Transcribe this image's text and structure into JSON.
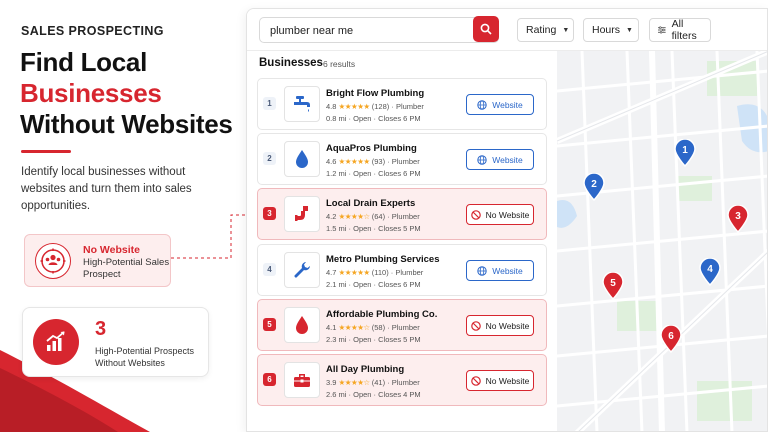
{
  "promo": {
    "eyebrow": "SALES PROSPECTING",
    "headline_line1": "Find Local",
    "headline_line2": "Businesses",
    "headline_line3": "Without Websites",
    "subtext": "Identify local businesses without websites and turn them into sales opportunities.",
    "nowebsite_card": {
      "title": "No Website",
      "subtitle": "High-Potential Sales Prospect",
      "icon": "target-people-icon"
    },
    "count_card": {
      "number": "3",
      "label": "High-Potential Prospects Without Websites",
      "icon": "growth-chart-icon"
    }
  },
  "colors": {
    "accent": "#d7262f",
    "link_blue": "#2b67c9",
    "star": "#f5a623",
    "flag_bg": "#fdeeee"
  },
  "search": {
    "value": "plumber near me",
    "placeholder": "Search",
    "button_icon": "search-icon"
  },
  "filters": {
    "rating": "Rating",
    "hours": "Hours",
    "all": "All filters"
  },
  "list": {
    "title": "Businesses",
    "count": "6 results",
    "rows": [
      {
        "index": "1",
        "name": "Bright Flow Plumbing",
        "rating": "4.8",
        "stars": "★★★★★",
        "reviews": "(128)",
        "category": "Plumber",
        "distance": "0.8 mi",
        "status": "Open",
        "closes": "Closes 6 PM",
        "action": "Website",
        "has_website": true,
        "icon": "faucet-icon"
      },
      {
        "index": "2",
        "name": "AquaPros Plumbing",
        "rating": "4.6",
        "stars": "★★★★★",
        "reviews": "(93)",
        "category": "Plumber",
        "distance": "1.2 mi",
        "status": "Open",
        "closes": "Closes 6 PM",
        "action": "Website",
        "has_website": true,
        "icon": "water-drop-icon"
      },
      {
        "index": "3",
        "name": "Local Drain Experts",
        "rating": "4.2",
        "stars": "★★★★☆",
        "reviews": "(64)",
        "category": "Plumber",
        "distance": "1.5 mi",
        "status": "Open",
        "closes": "Closes 5 PM",
        "action": "No Website",
        "has_website": false,
        "icon": "pipe-icon"
      },
      {
        "index": "4",
        "name": "Metro Plumbing Services",
        "rating": "4.7",
        "stars": "★★★★★",
        "reviews": "(110)",
        "category": "Plumber",
        "distance": "2.1 mi",
        "status": "Open",
        "closes": "Closes 6 PM",
        "action": "Website",
        "has_website": true,
        "icon": "wrench-icon"
      },
      {
        "index": "5",
        "name": "Affordable Plumbing Co.",
        "rating": "4.1",
        "stars": "★★★★☆",
        "reviews": "(58)",
        "category": "Plumber",
        "distance": "2.3 mi",
        "status": "Open",
        "closes": "Closes 5 PM",
        "action": "No Website",
        "has_website": false,
        "icon": "water-drop-icon"
      },
      {
        "index": "6",
        "name": "All Day Plumbing",
        "rating": "3.9",
        "stars": "★★★★☆",
        "reviews": "(41)",
        "category": "Plumber",
        "distance": "2.6 mi",
        "status": "Open",
        "closes": "Closes 4 PM",
        "action": "No Website",
        "has_website": false,
        "icon": "toolbox-icon"
      }
    ]
  },
  "map": {
    "pins": [
      {
        "label": "1",
        "type": "website"
      },
      {
        "label": "2",
        "type": "website"
      },
      {
        "label": "3",
        "type": "no-website"
      },
      {
        "label": "4",
        "type": "website"
      },
      {
        "label": "5",
        "type": "no-website"
      },
      {
        "label": "6",
        "type": "no-website"
      }
    ]
  }
}
